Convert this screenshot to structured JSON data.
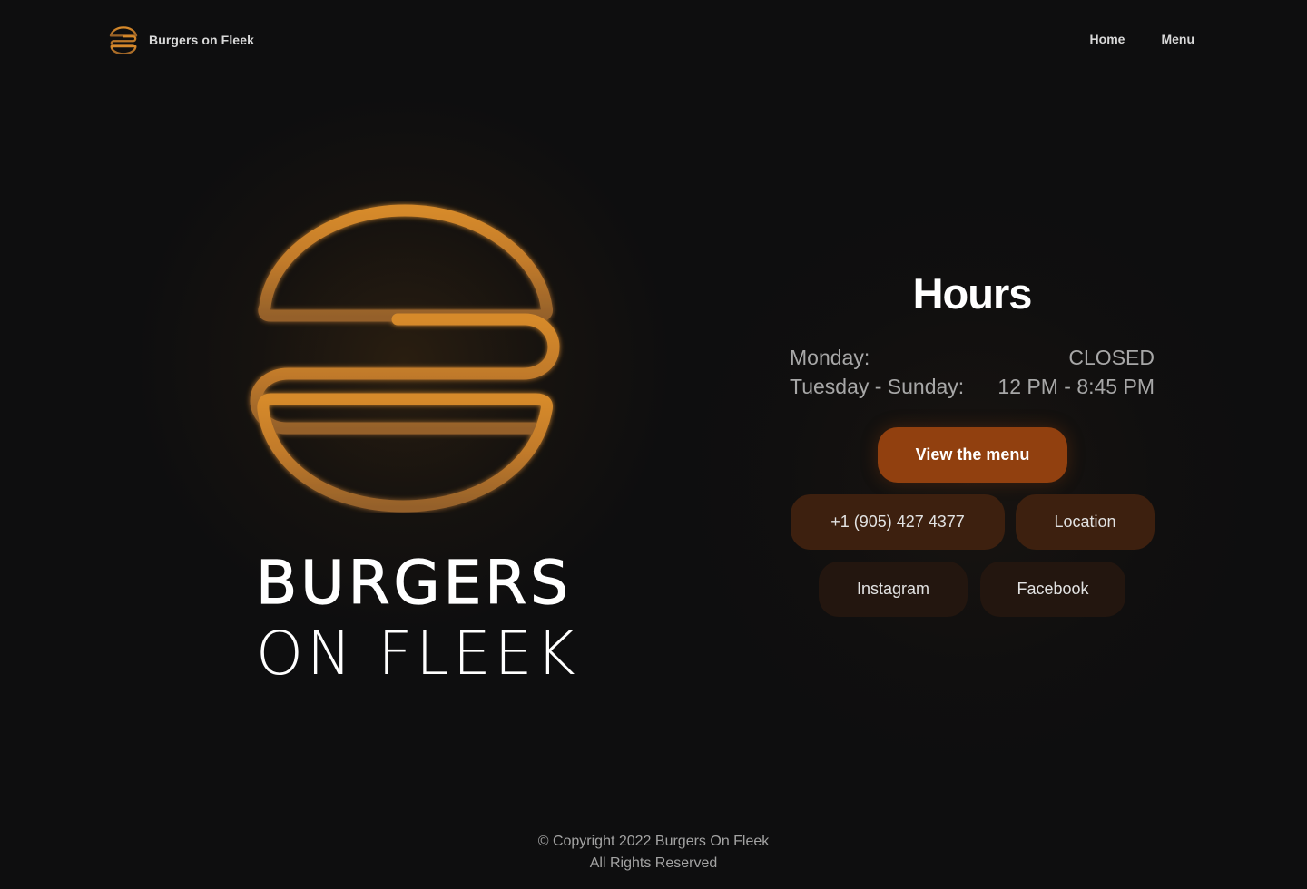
{
  "header": {
    "brand_name": "Burgers on Fleek",
    "brand_icon": "burger-logo-icon",
    "nav": [
      {
        "label": "Home"
      },
      {
        "label": "Menu"
      }
    ]
  },
  "hero": {
    "logo_icon": "burger-logo-icon",
    "wordmark_line1": "BURGERS",
    "wordmark_line2": "ON FLEEK"
  },
  "hours": {
    "title": "Hours",
    "rows": [
      {
        "day": "Monday:",
        "time": "CLOSED"
      },
      {
        "day": "Tuesday - Sunday:",
        "time": "12 PM - 8:45 PM"
      }
    ]
  },
  "actions": {
    "view_menu": "View the menu",
    "phone": "+1 (905) 427 4377",
    "location": "Location",
    "instagram": "Instagram",
    "facebook": "Facebook"
  },
  "footer": {
    "copyright": "© Copyright 2022 Burgers On Fleek",
    "rights": "All Rights Reserved"
  },
  "colors": {
    "background": "#0e0e0f",
    "accent_gold": "#c7832a",
    "primary_button": "#91400f",
    "secondary_button": "#3d200f",
    "tertiary_button": "#23160f"
  }
}
